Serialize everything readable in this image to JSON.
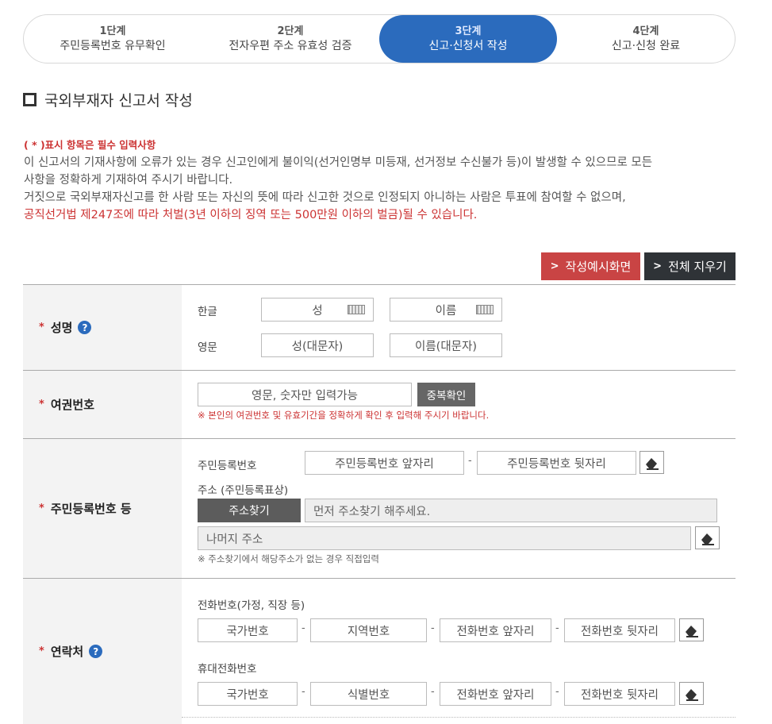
{
  "steps": [
    {
      "num": "1단계",
      "label": "주민등록번호 유무확인"
    },
    {
      "num": "2단계",
      "label": "전자우편 주소 유효성 검증"
    },
    {
      "num": "3단계",
      "label": "신고·신청서 작성"
    },
    {
      "num": "4단계",
      "label": "신고·신청 완료"
    }
  ],
  "active_step": 3,
  "section_title": "국외부재자 신고서 작성",
  "notice": {
    "required": "( * )표시 항목은 필수 입력사항",
    "line1": "이 신고서의 기재사항에 오류가 있는 경우 신고인에게 불이익(선거인명부 미등재, 선거정보 수신불가 등)이 발생할 수 있으므로 모든",
    "line2": "사항을 정확하게 기재하여 주시기 바랍니다.",
    "line3": "거짓으로 국외부재자신고를 한 사람 또는 자신의 뜻에 따라 신고한 것으로 인정되지 아니하는 사람은 투표에 참여할 수 없으며,",
    "line4": "공직선거법 제247조에 따라 처벌(3년 이하의 징역 또는 500만원 이하의 벌금)될 수 있습니다."
  },
  "buttons": {
    "example": "작성예시화면",
    "clear_all": "전체 지우기",
    "chevron": ">"
  },
  "name_row": {
    "label": "성명",
    "korean_label": "한글",
    "korean_surname": "성",
    "korean_given": "이름",
    "english_label": "영문",
    "english_surname": "성(대문자)",
    "english_given": "이름(대문자)"
  },
  "passport_row": {
    "label": "여권번호",
    "placeholder": "영문, 숫자만 입력가능",
    "check_button": "중복확인",
    "warning": "※ 본인의 여권번호 및 유효기간을 정확하게 확인 후 입력해 주시기 바랍니다."
  },
  "resident_row": {
    "label": "주민등록번호 등",
    "rrn_label": "주민등록번호",
    "rrn_front": "주민등록번호 앞자리",
    "rrn_back": "주민등록번호 뒷자리",
    "address_label": "주소 (주민등록표상)",
    "search_button": "주소찾기",
    "address_placeholder": "먼저 주소찾기 해주세요.",
    "rest_placeholder": "나머지 주소",
    "address_note": "※ 주소찾기에서 해당주소가 없는 경우 직접입력"
  },
  "contact_row": {
    "label": "연락처",
    "phone_label": "전화번호(가정, 직장 등)",
    "phone_fields": [
      "국가번호",
      "지역번호",
      "전화번호 앞자리",
      "전화번호 뒷자리"
    ],
    "mobile_label": "휴대전화번호",
    "mobile_fields": [
      "국가번호",
      "식별번호",
      "전화번호 앞자리",
      "전화번호 뒷자리"
    ]
  },
  "separator": "-",
  "star": "*",
  "question_mark": "?",
  "colors": {
    "accent": "#2b6bbd",
    "danger": "#c94444",
    "dark": "#2f3337",
    "required": "#cc3333"
  }
}
